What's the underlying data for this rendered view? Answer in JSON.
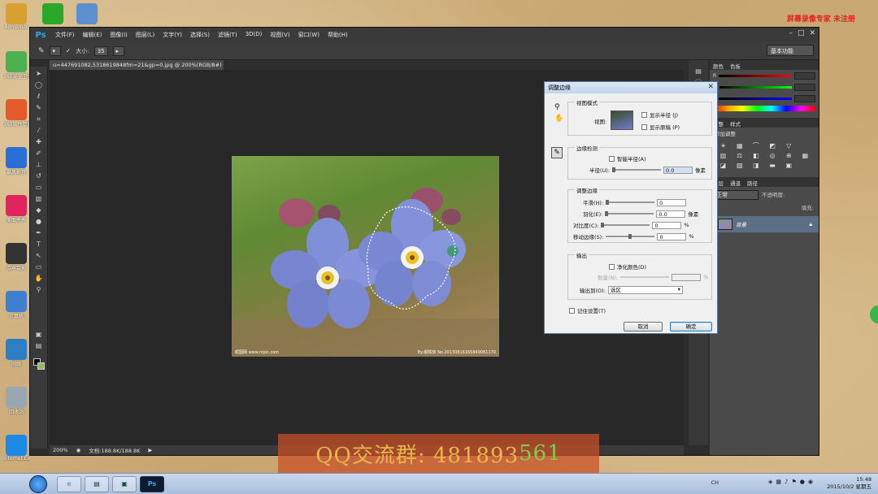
{
  "desktop": {
    "icons": [
      {
        "label": "Administr",
        "icon": "user-folder-icon",
        "color": "#d8a030"
      },
      {
        "label": "360安全卫士",
        "icon": "360-guard-icon",
        "color": "#4caf50"
      },
      {
        "label": "360软件管家",
        "icon": "360-software-icon",
        "color": "#e55a2b"
      },
      {
        "label": "暴风影音",
        "icon": "media-player-icon",
        "color": "#2b6fd6"
      },
      {
        "label": "美图秀秀",
        "icon": "meitu-icon",
        "color": "#e0245e"
      },
      {
        "label": "会声会影",
        "icon": "video-editor-icon",
        "color": "#333333"
      },
      {
        "label": "计算机",
        "icon": "computer-icon",
        "color": "#3f7fd0"
      },
      {
        "label": "网络",
        "icon": "network-icon",
        "color": "#2d7ec4"
      },
      {
        "label": "回收站",
        "icon": "recycle-bin-icon",
        "color": "#9aa6b2"
      },
      {
        "label": "Internet Explorer",
        "icon": "ie-icon",
        "color": "#1e88e5"
      }
    ],
    "recording_watermark": "屏幕录像专家 未注册"
  },
  "photoshop": {
    "logo": "Ps",
    "menus": [
      "文件(F)",
      "编辑(E)",
      "图像(I)",
      "图层(L)",
      "文字(Y)",
      "选择(S)",
      "滤镜(T)",
      "3D(D)",
      "视图(V)",
      "窗口(W)",
      "帮助(H)"
    ],
    "options": {
      "size_label": "大小:",
      "size_value": "35",
      "workspace": "基本功能"
    },
    "doc_tab": "u=447691082,5318619848fm=21&gp=0.jpg @ 200%(RGB/8#)",
    "image_caption_left": "昵图网 www.nipic.com",
    "image_caption_right": "By:钢铁侠 No.20130816165849061170",
    "status": {
      "zoom": "200%",
      "doc": "文档:188.8K/188.8K"
    },
    "panels": {
      "color_tabs": [
        "颜色",
        "色板"
      ],
      "color_channels": [
        "R",
        "G",
        "B"
      ],
      "adjust_tabs": [
        "调整",
        "样式"
      ],
      "adjust_heading": "添加调整",
      "layers_tabs": [
        "图层",
        "通道",
        "路径"
      ],
      "blend_mode": "正常",
      "opacity_label": "不透明度:",
      "fill_label": "填充:",
      "layer_name": "背景"
    }
  },
  "dialog": {
    "title": "调整边缘",
    "view_mode": {
      "group": "视图模式",
      "view_label": "视图:",
      "show_radius": "显示半径 (J)",
      "show_original": "显示原稿 (P)"
    },
    "edge_detection": {
      "group": "边缘检测",
      "smart_radius": "智能半径(A)",
      "radius_label": "半径(U):",
      "radius_value": "0.0",
      "radius_unit": "像素"
    },
    "adjust_edge": {
      "group": "调整边缘",
      "rows": [
        {
          "label": "平滑(H):",
          "value": "0",
          "unit": ""
        },
        {
          "label": "羽化(E):",
          "value": "0.0",
          "unit": "像素"
        },
        {
          "label": "对比度(C):",
          "value": "0",
          "unit": "%"
        },
        {
          "label": "移动边缘(S):",
          "value": "0",
          "unit": "%"
        }
      ]
    },
    "output": {
      "group": "输出",
      "decontaminate": "净化颜色(D)",
      "amount_label": "数量(N):",
      "amount_unit": "%",
      "output_to_label": "输出到(O):",
      "output_to_value": "选区"
    },
    "remember": "记住设置(T)",
    "cancel": "取消",
    "ok": "确定"
  },
  "banner": {
    "prefix": "QQ交流群: 481893",
    "suffix": "561"
  },
  "taskbar": {
    "ime": "CH",
    "time": "15:48",
    "date": "2015/10/2 星期五"
  }
}
